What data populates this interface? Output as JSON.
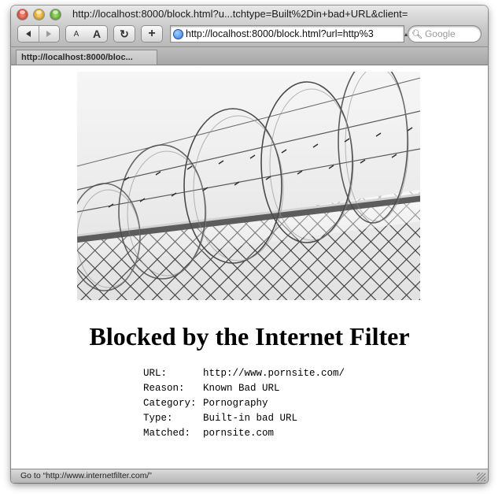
{
  "window": {
    "title": "http://localhost:8000/block.html?u...tchtype=Built%2Din+bad+URL&client=",
    "controls": [
      "close",
      "minimize",
      "zoom"
    ]
  },
  "toolbar": {
    "back_icon": "back-arrow-icon",
    "forward_icon": "forward-arrow-icon",
    "text_smaller_label": "A",
    "text_bigger_label": "A",
    "reload_icon": "↻",
    "add_bookmark_label": "+",
    "address": "http://localhost:8000/block.html?url=http%3",
    "search_placeholder": "Google"
  },
  "tabs": [
    {
      "label": "http://localhost:8000/bloc..."
    }
  ],
  "page": {
    "heading": "Blocked by the Internet Filter",
    "details": [
      {
        "label": "URL:",
        "value": "http://www.pornsite.com/"
      },
      {
        "label": "Reason:",
        "value": "Known Bad URL"
      },
      {
        "label": "Category:",
        "value": "Pornography"
      },
      {
        "label": "Type:",
        "value": "Built-in bad URL"
      },
      {
        "label": "Matched:",
        "value": "pornsite.com"
      }
    ]
  },
  "status": {
    "text": "Go to “http://www.internetfilter.com/”"
  }
}
